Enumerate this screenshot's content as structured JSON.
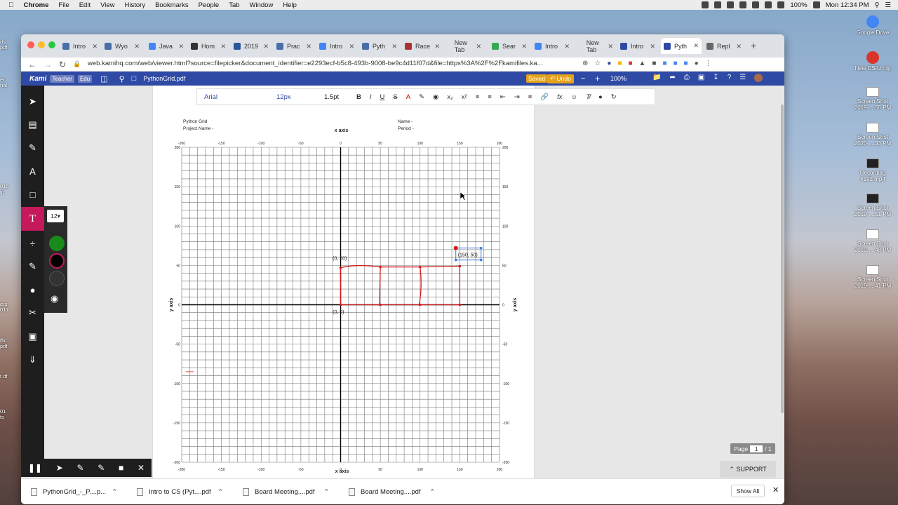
{
  "menubar": {
    "app": "Chrome",
    "items": [
      "File",
      "Edit",
      "View",
      "History",
      "Bookmarks",
      "People",
      "Tab",
      "Window",
      "Help"
    ],
    "battery": "100%",
    "clock": "Mon 12:34 PM"
  },
  "desktop": {
    "items": [
      {
        "label": "Google Drive"
      },
      {
        "label": "New CSIU.rdp"
      },
      {
        "label": "Screen Shot 2019-....55 PM"
      },
      {
        "label": "Screen Shot 2020-....33 PM"
      },
      {
        "label": "Recording #193.mp4"
      },
      {
        "label": "Screen Shot 2019-....51 PM"
      },
      {
        "label": "Screen Shot 2019-....48 PM"
      },
      {
        "label": "Screen Shot 2019-....41 PM"
      }
    ],
    "left": [
      "rls pdf",
      "et nal",
      "015 ip",
      "ers 017",
      "ffic pdf",
      "t df",
      "01 ts"
    ]
  },
  "tabs": [
    {
      "label": "Intro",
      "color": "#4a6ea8"
    },
    {
      "label": "Wyo",
      "color": "#4a6ea8"
    },
    {
      "label": "Java",
      "color": "#4285f4"
    },
    {
      "label": "Hom",
      "color": "#333"
    },
    {
      "label": "2019",
      "color": "#2b579a"
    },
    {
      "label": "Prac",
      "color": "#4a6ea8"
    },
    {
      "label": "Intro",
      "color": "#4285f4"
    },
    {
      "label": "Pyth",
      "color": "#4a6ea8"
    },
    {
      "label": "Race",
      "color": "#a33"
    },
    {
      "label": "New Tab",
      "color": "#dee1e6"
    },
    {
      "label": "Sear",
      "color": "#34a853"
    },
    {
      "label": "Intro",
      "color": "#4285f4"
    },
    {
      "label": "New Tab",
      "color": "#dee1e6"
    },
    {
      "label": "Intro",
      "color": "#2f4aa5"
    },
    {
      "label": "Pyth",
      "color": "#2f4aa5"
    },
    {
      "label": "Repl",
      "color": "#666"
    }
  ],
  "url": "web.kamihq.com/web/viewer.html?source=filepicker&document_identifier=e2293ecf-b5c8-493b-9008-be9c4d11f07d&file=https%3A%2F%2Fkamifiles.ka...",
  "kami": {
    "logo": "Kami",
    "badge1": "Teacher",
    "badge2": "Edu",
    "filename": "PythonGrid.pdf",
    "saved": "Saved",
    "undo": "Undo",
    "zoom": "100%"
  },
  "format": {
    "font": "Arial",
    "size": "12px",
    "spacing": "1.5pt"
  },
  "subpanel": {
    "size": "12"
  },
  "doc": {
    "title": "Python Grid",
    "project": "Project Name -",
    "name": "Name -",
    "period": "Period -",
    "xaxis": "x axis",
    "yaxis": "y axis",
    "labels": {
      "origin": "(0, 0)",
      "p1": "(0, 50)",
      "p2": "(150, 50)"
    },
    "ticks": [
      "-200",
      "-150",
      "-100",
      "-50",
      "0",
      "50",
      "100",
      "150",
      "200"
    ]
  },
  "page_indicator": {
    "label": "Page",
    "current": "1",
    "total": "/ 1"
  },
  "support": "SUPPORT",
  "downloads": [
    {
      "label": "PythonGrid_-_P....p..."
    },
    {
      "label": "Intro to CS (Pyt....pdf"
    },
    {
      "label": "Board Meeting....pdf"
    },
    {
      "label": "Board Meeting....pdf"
    }
  ],
  "show_all": "Show All"
}
